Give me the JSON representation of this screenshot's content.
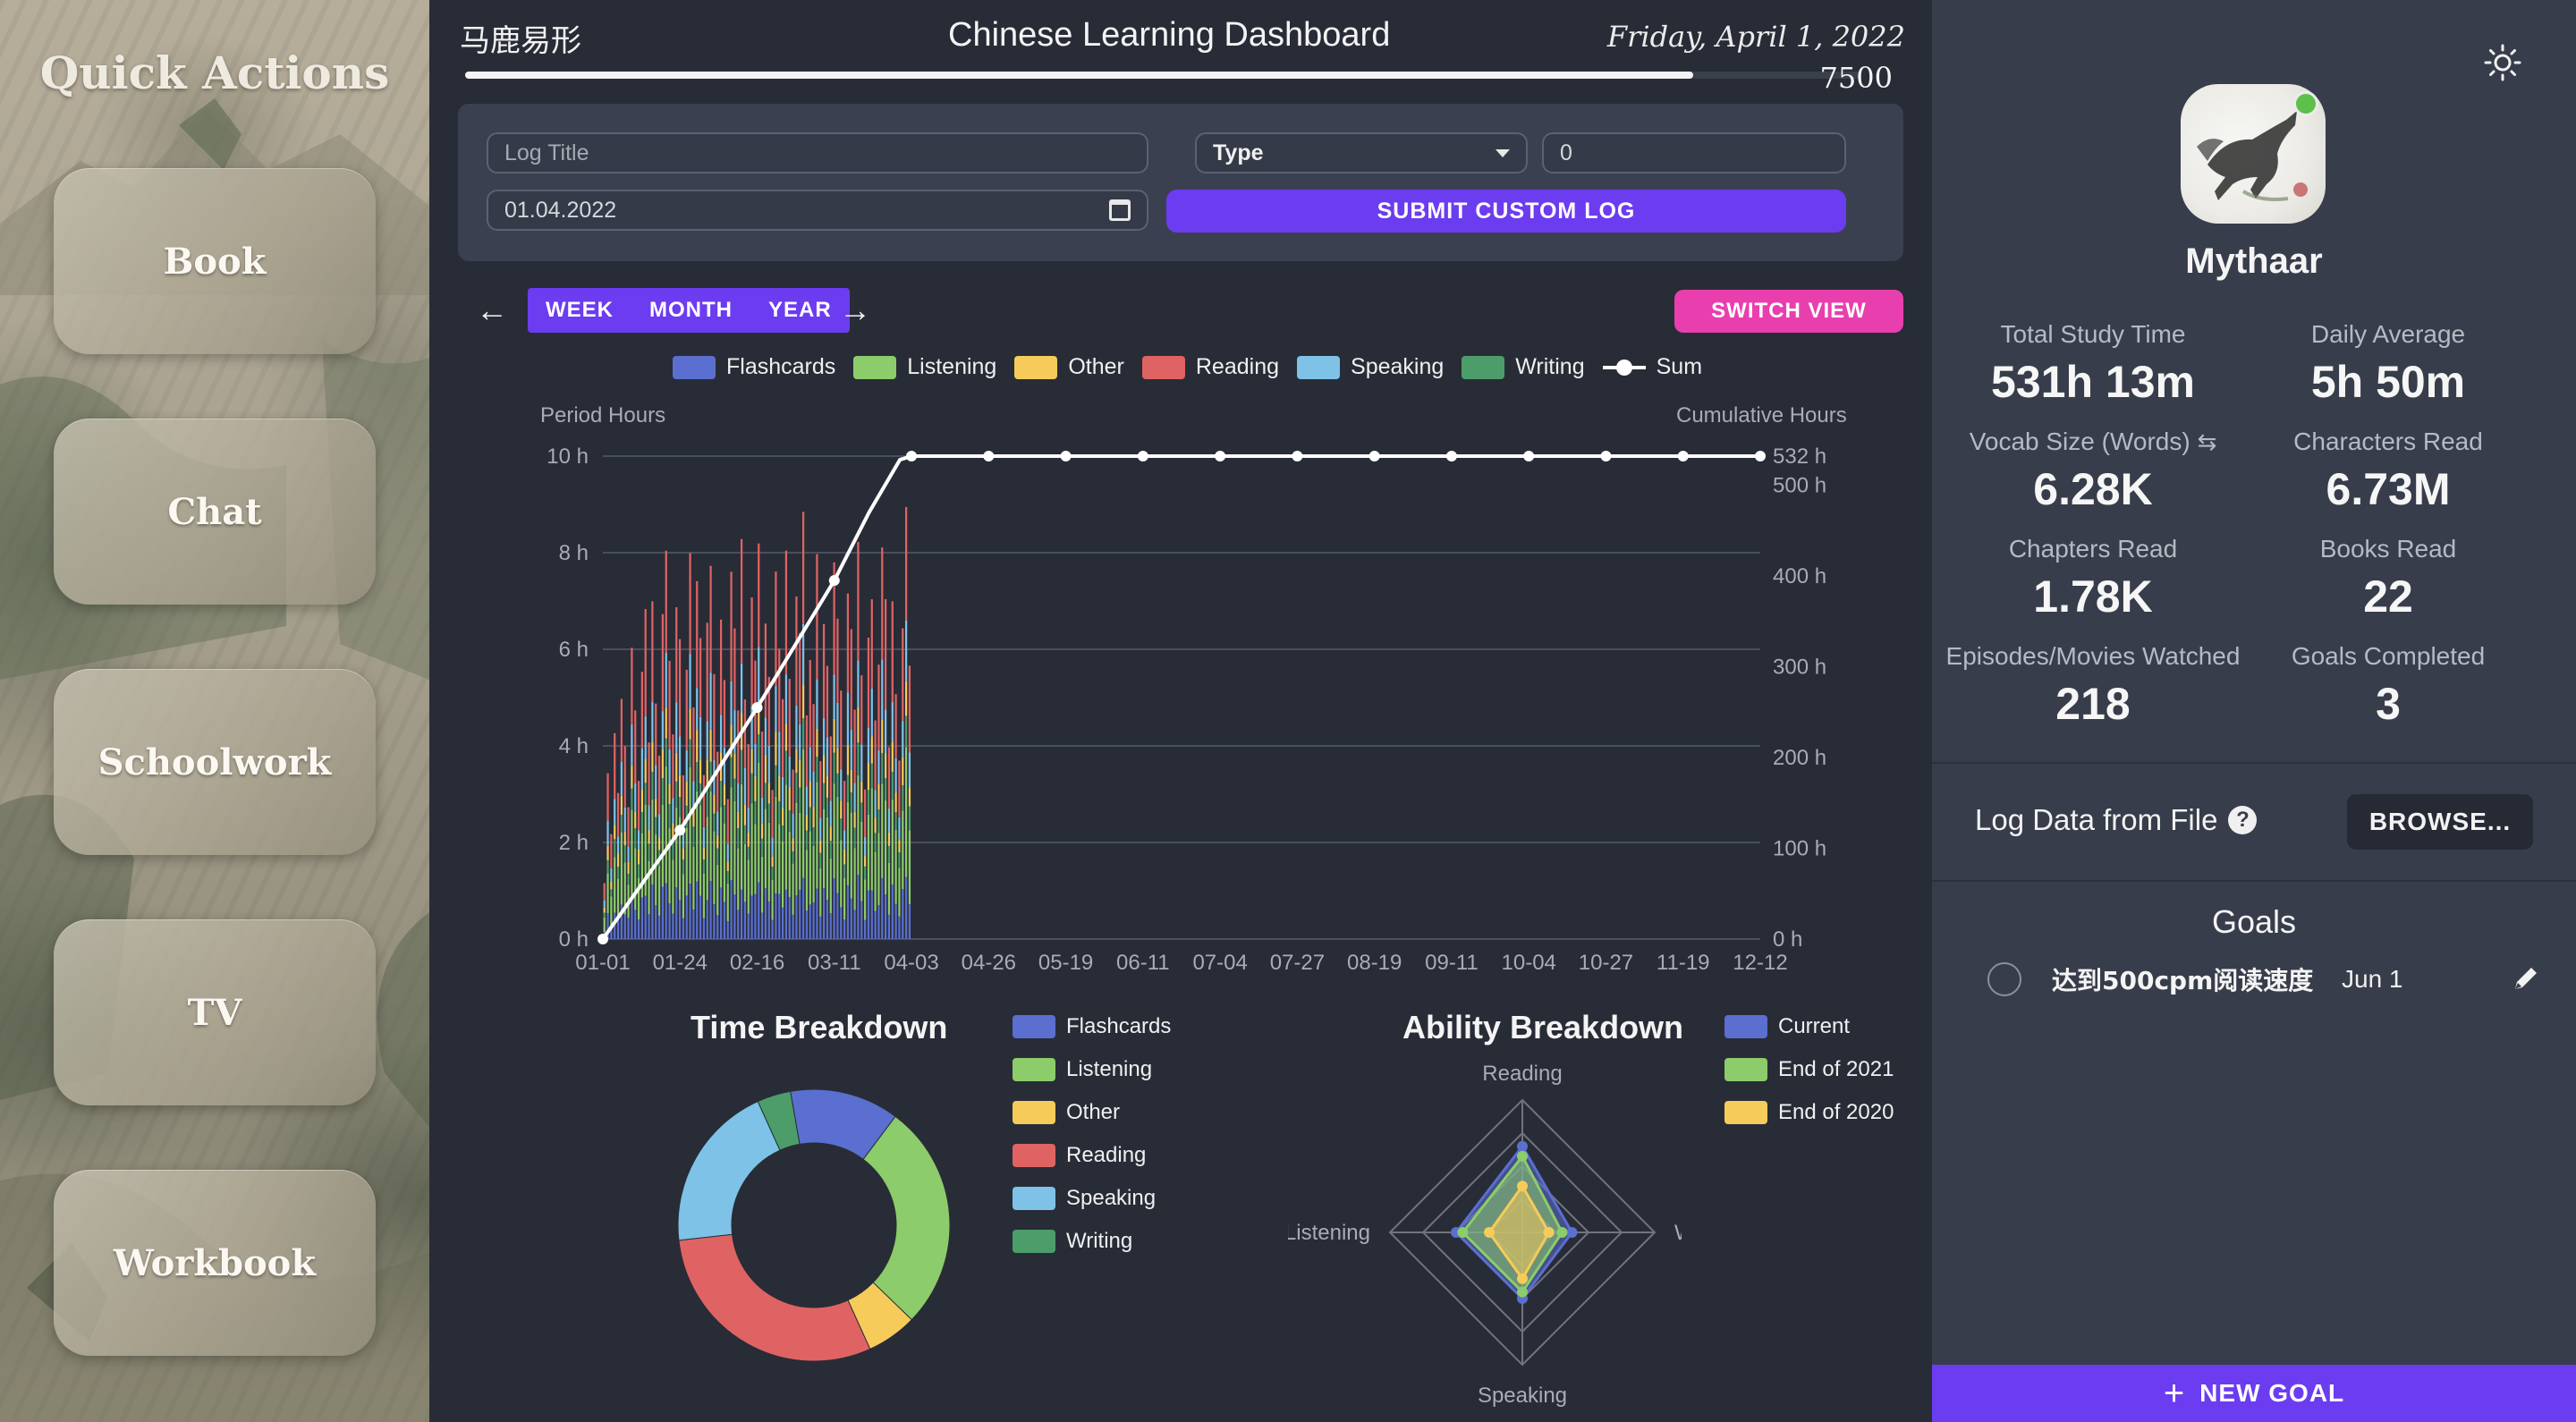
{
  "sidebar": {
    "title": "Quick Actions",
    "buttons": [
      {
        "label": "Book"
      },
      {
        "label": "Chat"
      },
      {
        "label": "Schoolwork"
      },
      {
        "label": "TV"
      },
      {
        "label": "Workbook"
      }
    ]
  },
  "header": {
    "chinese": "马鹿易形",
    "title": "Chinese Learning Dashboard",
    "date": "Friday, April 1, 2022",
    "progress_value": "7500",
    "progress_fraction": 0.88
  },
  "log_form": {
    "title_placeholder": "Log Title",
    "type_label": "Type",
    "amount_value": "0",
    "date_value": "01.04.2022",
    "submit_label": "SUBMIT CUSTOM LOG"
  },
  "chart_controls": {
    "prev_icon": "arrow-left-icon",
    "next_icon": "arrow-right-icon",
    "periods": [
      "WEEK",
      "MONTH",
      "YEAR"
    ],
    "switch_label": "SWITCH VIEW"
  },
  "chart_data": [
    {
      "type": "bar",
      "stacked": true,
      "left_axis_title": "Period Hours",
      "right_axis_title": "Cumulative Hours",
      "left_ticks": [
        "0 h",
        "2 h",
        "4 h",
        "6 h",
        "8 h",
        "10 h"
      ],
      "right_ticks": [
        "0 h",
        "100 h",
        "200 h",
        "300 h",
        "400 h",
        "500 h",
        "532 h"
      ],
      "ylim": [
        0,
        10
      ],
      "y2lim": [
        0,
        532
      ],
      "x_ticks": [
        "01-01",
        "01-24",
        "02-16",
        "03-11",
        "04-03",
        "04-26",
        "05-19",
        "06-11",
        "07-04",
        "07-27",
        "08-19",
        "09-11",
        "10-04",
        "10-27",
        "11-19",
        "12-12"
      ],
      "series": [
        {
          "name": "Flashcards",
          "color": "#5b6fd0"
        },
        {
          "name": "Listening",
          "color": "#8ccc6a"
        },
        {
          "name": "Other",
          "color": "#f6cb5a"
        },
        {
          "name": "Reading",
          "color": "#e06363"
        },
        {
          "name": "Speaking",
          "color": "#7ec2e8"
        },
        {
          "name": "Writing",
          "color": "#4c9d6a"
        }
      ],
      "daily_totals_h": [
        1.2,
        3.6,
        2.1,
        4.4,
        3.2,
        5.1,
        4.0,
        2.8,
        6.0,
        4.6,
        3.4,
        5.8,
        6.6,
        4.2,
        7.4,
        5.0,
        3.8,
        6.9,
        8.0,
        5.6,
        4.4,
        7.2,
        6.0,
        3.5,
        5.9,
        8.2,
        4.8,
        7.6,
        6.2,
        3.3,
        6.8,
        8.1,
        5.3,
        4.0,
        7.0,
        5.5,
        2.9,
        7.8,
        6.4,
        4.6,
        8.6,
        5.2,
        3.9,
        7.3,
        6.1,
        8.4,
        4.3,
        6.7,
        5.4,
        3.0,
        7.9,
        6.3,
        4.8,
        8.3,
        5.7,
        3.6,
        7.1,
        6.5,
        8.8,
        4.5,
        6.0,
        5.1,
        7.7,
        3.8,
        6.9,
        5.8,
        4.2,
        8.0,
        6.6,
        5.0,
        3.4,
        7.5,
        6.2,
        4.9,
        8.7,
        5.6,
        3.1,
        6.4,
        7.0,
        4.4,
        5.9,
        8.5,
        6.8,
        4.1,
        7.4,
        5.2,
        3.7,
        6.6,
        8.9,
        5.5
      ],
      "composition": {
        "Flashcards": 0.14,
        "Listening": 0.27,
        "Other": 0.08,
        "Reading": 0.3,
        "Speaking": 0.13,
        "Writing": 0.08
      },
      "cumulative_series": {
        "name": "Sum",
        "color": "#ffffff",
        "points": [
          {
            "x": "01-01",
            "y": 0
          },
          {
            "x": "01-24",
            "y": 120
          },
          {
            "x": "02-16",
            "y": 255
          },
          {
            "x": "03-11",
            "y": 395
          },
          {
            "x": "04-03",
            "y": 532
          },
          {
            "x": "04-26",
            "y": 532
          },
          {
            "x": "05-19",
            "y": 532
          },
          {
            "x": "06-11",
            "y": 532
          },
          {
            "x": "07-04",
            "y": 532
          },
          {
            "x": "07-27",
            "y": 532
          },
          {
            "x": "08-19",
            "y": 532
          },
          {
            "x": "09-11",
            "y": 532
          },
          {
            "x": "10-04",
            "y": 532
          },
          {
            "x": "10-27",
            "y": 532
          },
          {
            "x": "11-19",
            "y": 532
          },
          {
            "x": "12-12",
            "y": 532
          }
        ]
      }
    },
    {
      "type": "pie",
      "donut": true,
      "title": "Time Breakdown",
      "slices": [
        {
          "name": "Flashcards",
          "value": 0.13,
          "color": "#5b6fd0"
        },
        {
          "name": "Listening",
          "value": 0.27,
          "color": "#8ccc6a"
        },
        {
          "name": "Other",
          "value": 0.06,
          "color": "#f6cb5a"
        },
        {
          "name": "Reading",
          "value": 0.3,
          "color": "#e06363"
        },
        {
          "name": "Speaking",
          "value": 0.2,
          "color": "#7ec2e8"
        },
        {
          "name": "Writing",
          "value": 0.04,
          "color": "#4c9d6a"
        }
      ]
    },
    {
      "type": "radar",
      "title": "Ability Breakdown",
      "axes": [
        "Reading",
        "Writing",
        "Speaking",
        "Listening"
      ],
      "rmax": 4,
      "series": [
        {
          "name": "Current",
          "color": "#5b6fd0",
          "values": [
            2.6,
            1.5,
            2.0,
            2.0
          ]
        },
        {
          "name": "End of 2021",
          "color": "#8ccc6a",
          "values": [
            2.3,
            1.2,
            1.8,
            1.8
          ]
        },
        {
          "name": "End of 2020",
          "color": "#f6cb5a",
          "values": [
            1.4,
            0.8,
            1.4,
            1.0
          ]
        }
      ]
    }
  ],
  "profile": {
    "username": "Mythaar",
    "stats": [
      {
        "label": "Total Study Time",
        "value": "531h 13m"
      },
      {
        "label": "Daily Average",
        "value": "5h 50m"
      },
      {
        "label": "Vocab Size (Words)",
        "value": "6.28K"
      },
      {
        "label": "Characters Read",
        "value": "6.73M"
      },
      {
        "label": "Chapters Read",
        "value": "1.78K"
      },
      {
        "label": "Books Read",
        "value": "22"
      },
      {
        "label": "Episodes/Movies Watched",
        "value": "218"
      },
      {
        "label": "Goals Completed",
        "value": "3"
      }
    ],
    "swap_icon": "swap-icon",
    "theme_icon": "sun-icon"
  },
  "file_log": {
    "label": "Log Data from File",
    "browse_label": "BROWSE..."
  },
  "goals": {
    "title": "Goals",
    "items": [
      {
        "text": "达到500cpm阅读速度",
        "date": "Jun 1"
      }
    ],
    "new_goal_label": "NEW GOAL"
  }
}
